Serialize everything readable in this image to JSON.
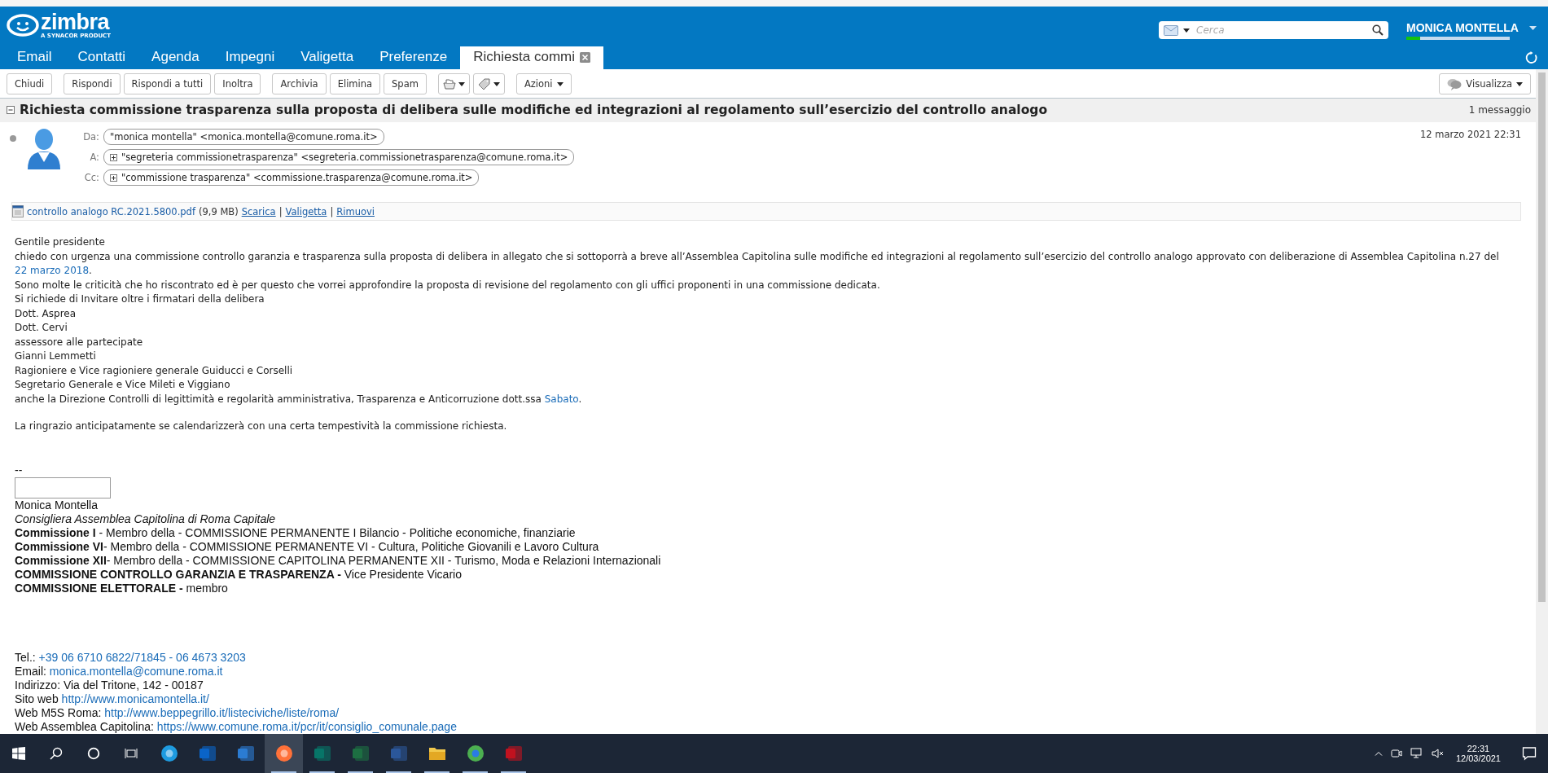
{
  "header": {
    "logo": "zimbra",
    "logo_tagline": "A SYNACOR PRODUCT",
    "search": {
      "placeholder": "Cerca"
    },
    "user": "MONICA MONTELLA",
    "quota": {
      "level": 0.13
    }
  },
  "tabs": [
    {
      "label": "Email",
      "selected": false,
      "closable": false
    },
    {
      "label": "Contatti",
      "selected": false,
      "closable": false
    },
    {
      "label": "Agenda",
      "selected": false,
      "closable": false
    },
    {
      "label": "Impegni",
      "selected": false,
      "closable": false
    },
    {
      "label": "Valigetta",
      "selected": false,
      "closable": false
    },
    {
      "label": "Preferenze",
      "selected": false,
      "closable": false
    },
    {
      "label": "Richiesta commi",
      "selected": true,
      "closable": true
    }
  ],
  "toolbar": {
    "groups": [
      [
        {
          "kind": "text",
          "label": "Chiudi"
        }
      ],
      [
        {
          "kind": "text",
          "label": "Rispondi"
        },
        {
          "kind": "text",
          "label": "Rispondi a tutti"
        },
        {
          "kind": "text",
          "label": "Inoltra"
        }
      ],
      [
        {
          "kind": "text",
          "label": "Archivia"
        },
        {
          "kind": "text",
          "label": "Elimina"
        },
        {
          "kind": "text",
          "label": "Spam"
        }
      ],
      [
        {
          "kind": "move"
        },
        {
          "kind": "tag"
        }
      ],
      [
        {
          "kind": "menu",
          "label": "Azioni"
        }
      ]
    ],
    "view": "Visualizza"
  },
  "conversation": {
    "subject": "Richiesta commissione trasparenza sulla proposta di delibera sulle modifiche ed integrazioni al regolamento sull’esercizio del controllo analogo",
    "count": "1 messaggio"
  },
  "message": {
    "date": "12 marzo 2021 22:31",
    "recipients": [
      {
        "label": "Da:",
        "address": "\"monica montella\" <monica.montella@comune.roma.it>",
        "expandable": false
      },
      {
        "label": "A:",
        "address": "\"segreteria commissionetrasparenza\" <segreteria.commissionetrasparenza@comune.roma.it>",
        "expandable": true
      },
      {
        "label": "Cc:",
        "address": "\"commissione trasparenza\" <commissione.trasparenza@comune.roma.it>",
        "expandable": true
      }
    ],
    "attachment": {
      "name": "controllo analogo RC.2021.5800.pdf",
      "size": "(9,9 MB)",
      "links": [
        "Scarica",
        "Valigetta",
        "Rimuovi"
      ],
      "separator": "|"
    },
    "body": [
      [
        [
          {
            "kind": "plain",
            "text": "Gentile presidente"
          }
        ],
        [
          {
            "kind": "plain",
            "text": "chiedo con urgenza una commissione controllo garanzia e trasparenza sulla proposta di delibera in allegato  che si sottoporrà a breve all’Assemblea Capitolina sulle modifiche ed integrazioni al regolamento sull’esercizio del controllo analogo approvato con deliberazione di Assemblea Capitolina n.27 del "
          },
          {
            "kind": "link",
            "text": "22 marzo 2018"
          },
          {
            "kind": "plain",
            "text": "."
          }
        ],
        [
          {
            "kind": "plain",
            "text": "Sono molte le criticità che ho riscontrato ed è per questo che vorrei approfondire la proposta di revisione del regolamento con gli uffici proponenti in una commissione dedicata."
          }
        ],
        [
          {
            "kind": "plain",
            "text": "Si richiede di Invitare oltre i firmatari della delibera"
          }
        ],
        [
          {
            "kind": "plain",
            "text": "Dott. Asprea"
          }
        ],
        [
          {
            "kind": "plain",
            "text": "Dott. Cervi"
          }
        ],
        [
          {
            "kind": "plain",
            "text": "assessore alle partecipate"
          }
        ],
        [
          {
            "kind": "plain",
            "text": "Gianni Lemmetti"
          }
        ],
        [
          {
            "kind": "plain",
            "text": "Ragioniere e Vice ragioniere generale Guiducci e Corselli"
          }
        ],
        [
          {
            "kind": "plain",
            "text": "Segretario Generale e Vice Mileti e Viggiano"
          }
        ],
        [
          {
            "kind": "plain",
            "text": "anche la Direzione Controlli di legittimità e regolarità amministrativa, Trasparenza e Anticorruzione dott.ssa "
          },
          {
            "kind": "link",
            "text": "Sabato"
          },
          {
            "kind": "plain",
            "text": "."
          }
        ]
      ],
      [
        [
          {
            "kind": "plain",
            "text": "La ringrazio anticipatamente se calendarizzerà con una certa tempestività la commissione richiesta."
          }
        ]
      ]
    ],
    "signature": {
      "separator": "--",
      "blocks": [
        [
          [
            {
              "kind": "plain",
              "text": "Monica Montella"
            }
          ],
          [
            {
              "kind": "italic",
              "text": "Consigliera Assemblea Capitolina di Roma Capitale"
            }
          ],
          [
            {
              "kind": "bold",
              "text": "Commissione I"
            },
            {
              "kind": "plain",
              "text": " - Membro della - COMMISSIONE PERMANENTE I Bilancio - Politiche economiche, finanziarie"
            }
          ],
          [
            {
              "kind": "bold",
              "text": "Commissione VI"
            },
            {
              "kind": "plain",
              "text": "- Membro della - COMMISSIONE PERMANENTE VI - Cultura, Politiche Giovanili e Lavoro Cultura"
            }
          ],
          [
            {
              "kind": "bold",
              "text": "Commissione XII"
            },
            {
              "kind": "plain",
              "text": "- Membro della - COMMISSIONE CAPITOLINA PERMANENTE XII - Turismo, Moda e Relazioni Internazionali"
            }
          ],
          [
            {
              "kind": "bold",
              "text": "COMMISSIONE CONTROLLO GARANZIA E TRASPARENZA -"
            },
            {
              "kind": "plain",
              "text": " Vice Presidente Vicario"
            }
          ],
          [
            {
              "kind": "bold",
              "text": "COMMISSIONE ELETTORALE -"
            },
            {
              "kind": "plain",
              "text": " membro"
            }
          ]
        ],
        [
          [
            {
              "kind": "plain",
              "text": "Tel.: "
            },
            {
              "kind": "link",
              "text": "+39 06 6710 6822/71845 - 06 4673 3203"
            }
          ],
          [
            {
              "kind": "plain",
              "text": "Email: "
            },
            {
              "kind": "link",
              "text": "monica.montella@comune.roma.it"
            }
          ],
          [
            {
              "kind": "plain",
              "text": "Indirizzo: Via del Tritone, 142 - 00187"
            }
          ],
          [
            {
              "kind": "plain",
              "text": "Sito web "
            },
            {
              "kind": "link",
              "text": "http://www.monicamontella.it/"
            }
          ],
          [
            {
              "kind": "plain",
              "text": "Web M5S Roma: "
            },
            {
              "kind": "link",
              "text": "http://www.beppegrillo.it/listeciviche/liste/roma/"
            }
          ],
          [
            {
              "kind": "plain",
              "text": "Web Assemblea Capitolina: "
            },
            {
              "kind": "link",
              "text": "https://www.comune.roma.it/pcr/it/consiglio_comunale.page"
            }
          ]
        ]
      ]
    }
  },
  "taskbar": {
    "apps": [
      {
        "kind": "edge",
        "running": false,
        "selected": false
      },
      {
        "kind": "mail",
        "running": false,
        "selected": false
      },
      {
        "kind": "store",
        "running": false,
        "selected": false
      },
      {
        "kind": "firefox",
        "running": true,
        "selected": true
      },
      {
        "kind": "publisher",
        "running": true,
        "selected": false
      },
      {
        "kind": "excel",
        "running": true,
        "selected": false
      },
      {
        "kind": "word",
        "running": true,
        "selected": false
      },
      {
        "kind": "folder",
        "running": true,
        "selected": false
      },
      {
        "kind": "chrome",
        "running": true,
        "selected": false
      },
      {
        "kind": "acrobat",
        "running": true,
        "selected": false
      }
    ],
    "time": "22:31",
    "date": "12/03/2021"
  }
}
